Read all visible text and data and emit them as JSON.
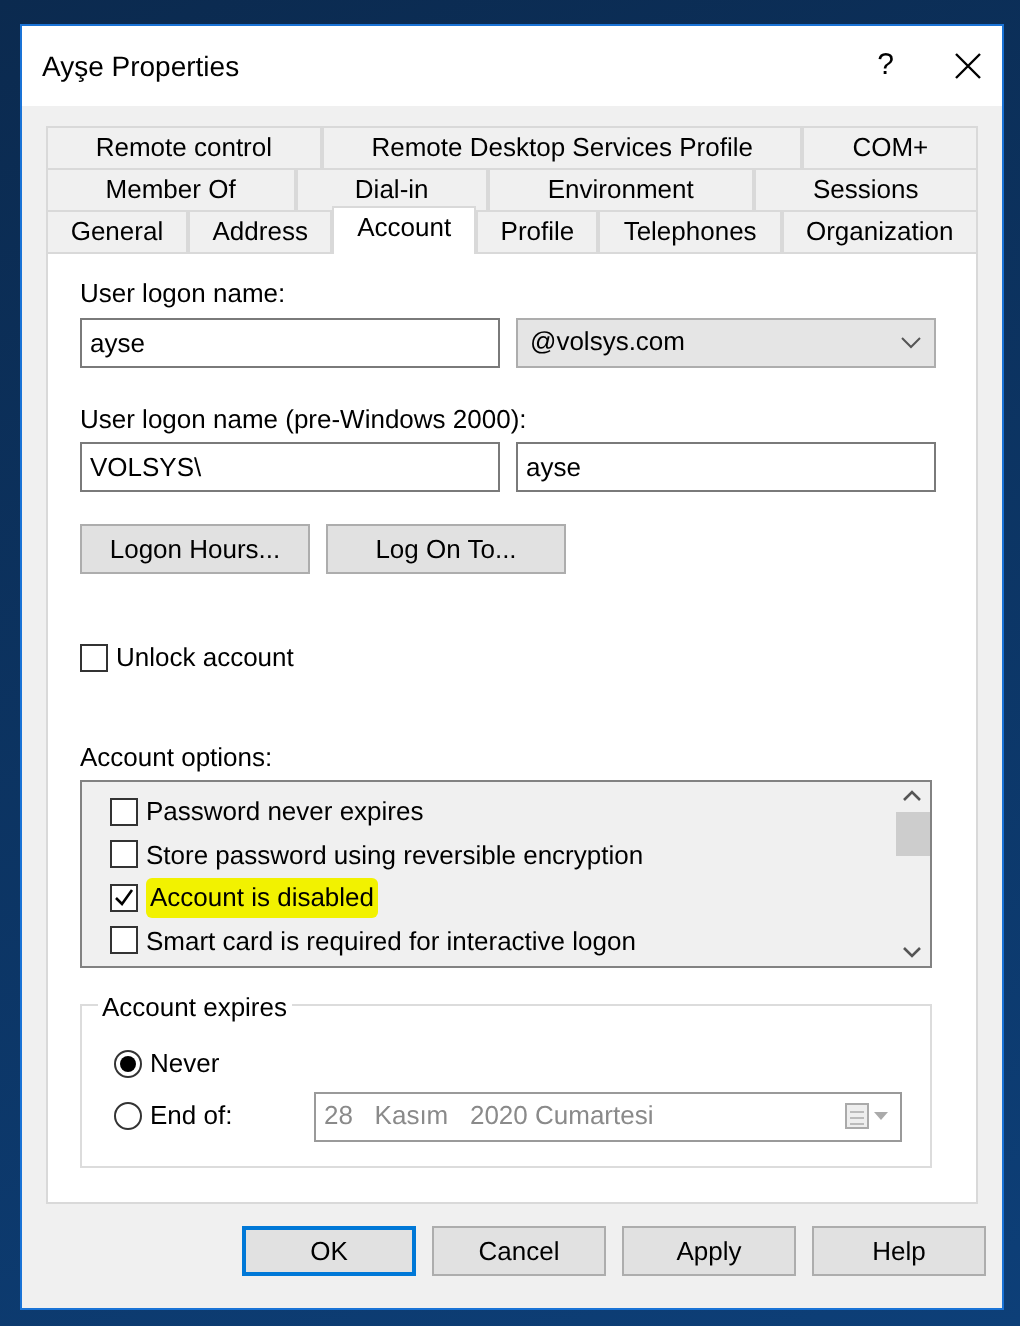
{
  "window": {
    "title": "Ayşe Properties",
    "help": "?"
  },
  "tab_rows": [
    [
      {
        "label": "Remote control",
        "selected": false
      },
      {
        "label": "Remote Desktop Services Profile",
        "selected": false
      },
      {
        "label": "COM+",
        "selected": false
      }
    ],
    [
      {
        "label": "Member Of",
        "selected": false
      },
      {
        "label": "Dial-in",
        "selected": false
      },
      {
        "label": "Environment",
        "selected": false
      },
      {
        "label": "Sessions",
        "selected": false
      }
    ],
    [
      {
        "label": "General",
        "selected": false
      },
      {
        "label": "Address",
        "selected": false
      },
      {
        "label": "Account",
        "selected": true
      },
      {
        "label": "Profile",
        "selected": false
      },
      {
        "label": "Telephones",
        "selected": false
      },
      {
        "label": "Organization",
        "selected": false
      }
    ]
  ],
  "logon_name": {
    "label": "User logon name:",
    "value": "ayse",
    "domain": "@volsys.com"
  },
  "pre2000": {
    "label": "User logon name (pre-Windows 2000):",
    "domain": "VOLSYS\\",
    "value": "ayse"
  },
  "action_buttons": [
    "Logon Hours...",
    "Log On To..."
  ],
  "unlock": {
    "label": "Unlock account",
    "checked": false
  },
  "account_options": {
    "label": "Account options:",
    "items": [
      {
        "label": "Password never expires",
        "checked": false,
        "highlighted": false
      },
      {
        "label": "Store password using reversible encryption",
        "checked": false,
        "highlighted": false
      },
      {
        "label": "Account is disabled",
        "checked": true,
        "highlighted": true
      },
      {
        "label": "Smart card is required for interactive logon",
        "checked": false,
        "highlighted": false
      }
    ]
  },
  "account_expires": {
    "legend": "Account expires",
    "options": [
      {
        "label": "Never",
        "selected": true
      },
      {
        "label": "End of:",
        "selected": false
      }
    ],
    "date": {
      "value": "28   Kasım   2020 Cumartesi",
      "disabled": true
    }
  },
  "buttons": [
    {
      "label": "OK",
      "focused": true
    },
    {
      "label": "Cancel",
      "focused": false
    },
    {
      "label": "Apply",
      "focused": false
    },
    {
      "label": "Help",
      "focused": false
    }
  ]
}
